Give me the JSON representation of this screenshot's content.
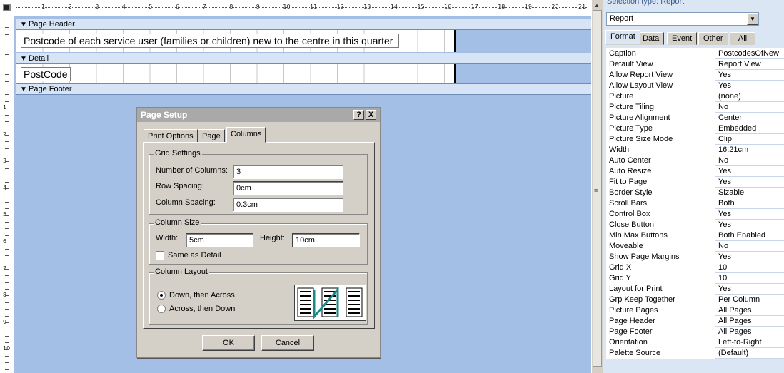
{
  "designer": {
    "ruler_labels": [
      "1",
      "2",
      "3",
      "4",
      "5",
      "6",
      "7",
      "8",
      "9",
      "10",
      "11",
      "12",
      "13",
      "14",
      "15",
      "16",
      "17",
      "18",
      "19",
      "20",
      "21"
    ],
    "vruler_labels": [
      "1",
      "2",
      "3",
      "4",
      "5",
      "6",
      "7",
      "8",
      "9",
      "10"
    ],
    "page_header": "Page Header",
    "header_field": "Postcode of each service user (families or children) new to the centre in this quarter",
    "detail": "Detail",
    "detail_field": "PostCode",
    "page_footer": "Page Footer"
  },
  "dialog": {
    "title": "Page Setup",
    "help_btn": "?",
    "close_btn": "X",
    "tabs": [
      "Print Options",
      "Page",
      "Columns"
    ],
    "active_tab": "Columns",
    "grid_settings": {
      "label": "Grid Settings",
      "num_columns_label": "Number of Columns:",
      "num_columns": "3",
      "row_spacing_label": "Row Spacing:",
      "row_spacing": "0cm",
      "column_spacing_label": "Column Spacing:",
      "column_spacing": "0.3cm"
    },
    "column_size": {
      "label": "Column Size",
      "width_label": "Width:",
      "width": "5cm",
      "height_label": "Height:",
      "height": "10cm",
      "same_as_detail": "Same as Detail"
    },
    "column_layout": {
      "label": "Column Layout",
      "option_down": "Down, then Across",
      "option_across": "Across, then Down",
      "selected": "Down, then Across"
    },
    "ok": "OK",
    "cancel": "Cancel"
  },
  "props": {
    "selection_type": "Selection type:  Report",
    "selected_object": "Report",
    "tabs": [
      "Format",
      "Data",
      "Event",
      "Other",
      "All"
    ],
    "active_tab": "Format",
    "rows": [
      {
        "name": "Caption",
        "value": "PostcodesOfNew"
      },
      {
        "name": "Default View",
        "value": "Report View"
      },
      {
        "name": "Allow Report View",
        "value": "Yes"
      },
      {
        "name": "Allow Layout View",
        "value": "Yes"
      },
      {
        "name": "Picture",
        "value": "(none)"
      },
      {
        "name": "Picture Tiling",
        "value": "No"
      },
      {
        "name": "Picture Alignment",
        "value": "Center"
      },
      {
        "name": "Picture Type",
        "value": "Embedded"
      },
      {
        "name": "Picture Size Mode",
        "value": "Clip"
      },
      {
        "name": "Width",
        "value": "16.21cm"
      },
      {
        "name": "Auto Center",
        "value": "No"
      },
      {
        "name": "Auto Resize",
        "value": "Yes"
      },
      {
        "name": "Fit to Page",
        "value": "Yes"
      },
      {
        "name": "Border Style",
        "value": "Sizable"
      },
      {
        "name": "Scroll Bars",
        "value": "Both"
      },
      {
        "name": "Control Box",
        "value": "Yes"
      },
      {
        "name": "Close Button",
        "value": "Yes"
      },
      {
        "name": "Min Max Buttons",
        "value": "Both Enabled"
      },
      {
        "name": "Moveable",
        "value": "No"
      },
      {
        "name": "Show Page Margins",
        "value": "Yes"
      },
      {
        "name": "Grid X",
        "value": "10"
      },
      {
        "name": "Grid Y",
        "value": "10"
      },
      {
        "name": "Layout for Print",
        "value": "Yes"
      },
      {
        "name": "Grp Keep Together",
        "value": "Per Column"
      },
      {
        "name": "Picture Pages",
        "value": "All Pages"
      },
      {
        "name": "Page Header",
        "value": "All Pages"
      },
      {
        "name": "Page Footer",
        "value": "All Pages"
      },
      {
        "name": "Orientation",
        "value": "Left-to-Right"
      },
      {
        "name": "Palette Source",
        "value": "(Default)"
      }
    ]
  }
}
